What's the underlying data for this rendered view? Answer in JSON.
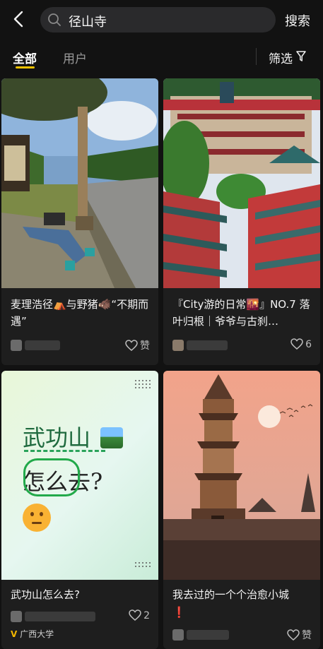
{
  "header": {
    "search_query": "径山寺",
    "search_button": "搜索"
  },
  "tabs": {
    "all": "全部",
    "users": "用户",
    "filter": "筛选"
  },
  "posts": [
    {
      "title": "麦理浩径⛺与野猪🐗“不期而遇”",
      "likes": "赞"
    },
    {
      "title": "『City游的日常🌇』NO.7 落叶归根｜爷爷与古刹…",
      "likes": "6"
    },
    {
      "title": "武功山怎么去?",
      "likes": "2",
      "school": "广西大学",
      "image_text_line1": "武功山",
      "image_text_line2": "怎么去?"
    },
    {
      "title": "我去过的一个个治愈小城",
      "title_emoji": "❗",
      "likes": "赞"
    }
  ],
  "colors": {
    "background": "#121212",
    "card": "#1e1e1e",
    "accent": "#f2c200"
  }
}
